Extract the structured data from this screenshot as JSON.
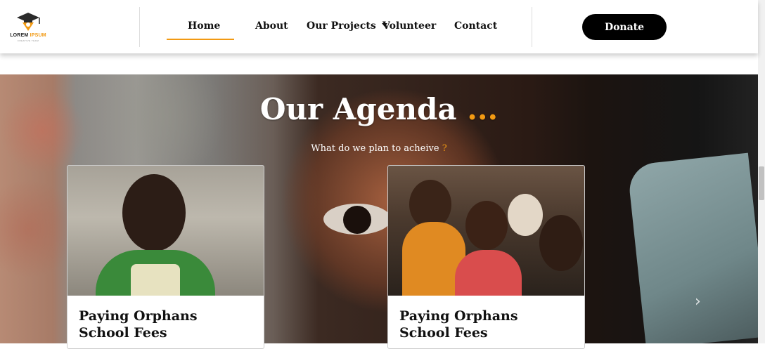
{
  "header": {
    "logo": {
      "word1": "LOREM",
      "word2": "IPSUM",
      "tagline": "CREATIVE TEAM"
    },
    "nav": [
      {
        "label": "Home",
        "active": true
      },
      {
        "label": "About"
      },
      {
        "label": "Our Projects",
        "has_dropdown": true
      },
      {
        "label": "Volunteer"
      },
      {
        "label": "Contact"
      }
    ],
    "donate_label": "Donate"
  },
  "hero": {
    "title": "Our Agenda",
    "title_dots": "...",
    "subtitle": "What do we plan to acheive",
    "subtitle_mark": "?",
    "next_arrow_icon": "chevron-right-icon"
  },
  "cards": [
    {
      "title": "Paying Orphans School Fees"
    },
    {
      "title": "Paying Orphans School Fees"
    }
  ],
  "colors": {
    "accent": "#f29a13",
    "donate_bg": "#000000",
    "header_bg": "#ffffff"
  }
}
